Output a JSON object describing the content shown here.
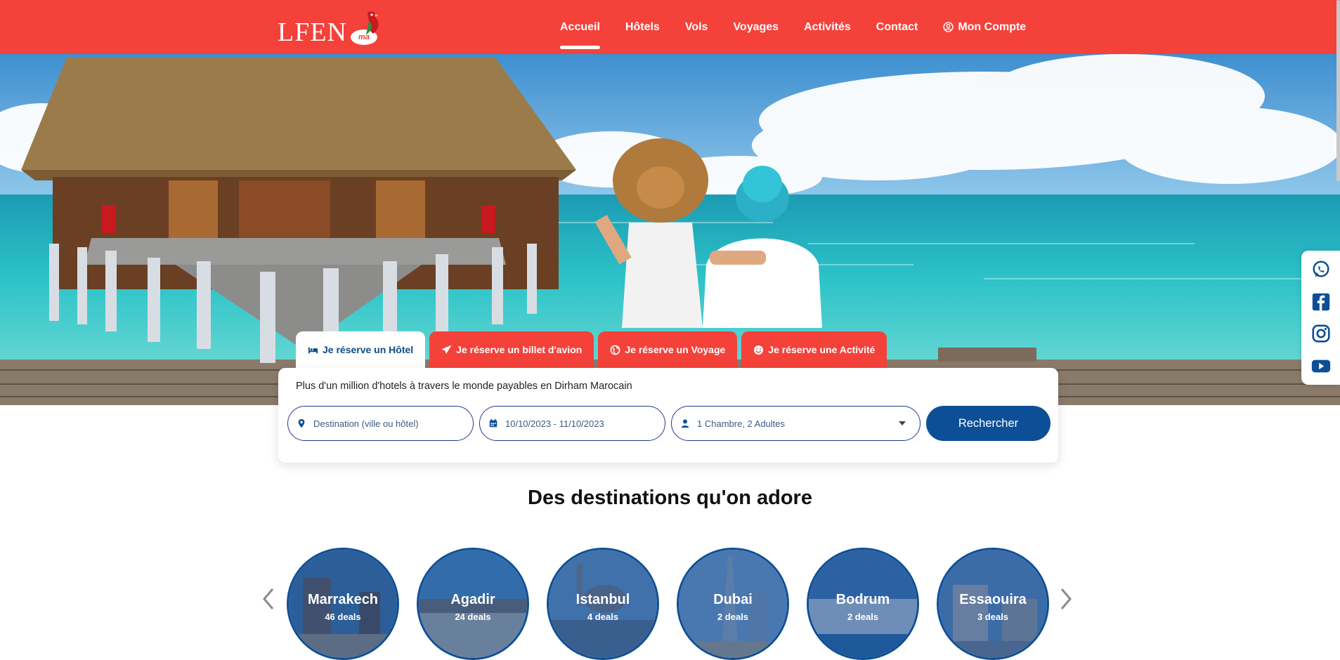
{
  "brand": {
    "logo_text": "LFEN",
    "logo_badge": "ma",
    "colors": {
      "primary_red": "#f4413a",
      "primary_blue": "#0d4f96",
      "white": "#ffffff"
    }
  },
  "nav": {
    "items": [
      {
        "label": "Accueil",
        "active": true
      },
      {
        "label": "Hôtels"
      },
      {
        "label": "Vols"
      },
      {
        "label": "Voyages"
      },
      {
        "label": "Activités"
      },
      {
        "label": "Contact"
      }
    ],
    "account_label": "Mon Compte",
    "account_icon": "user-circle-icon"
  },
  "social": [
    "whatsapp-icon",
    "facebook-icon",
    "instagram-icon",
    "youtube-icon"
  ],
  "tabs": [
    {
      "label": "Je réserve un Hôtel",
      "icon": "bed-icon",
      "active": true
    },
    {
      "label": "Je réserve un billet d'avion",
      "icon": "plane-icon"
    },
    {
      "label": "Je réserve un Voyage",
      "icon": "globe-icon"
    },
    {
      "label": "Je réserve une Activité",
      "icon": "smile-icon"
    }
  ],
  "search": {
    "tagline": "Plus d'un million d'hotels à travers le monde payables en Dirham Marocain",
    "destination_placeholder": "Destination (ville ou hôtel)",
    "dates_value": "10/10/2023 - 11/10/2023",
    "guests_value": "1 Chambre, 2 Adultes",
    "button_label": "Rechercher"
  },
  "destinations": {
    "title": "Des destinations qu'on adore",
    "items": [
      {
        "name": "Marrakech",
        "deals": "46 deals"
      },
      {
        "name": "Agadir",
        "deals": "24 deals"
      },
      {
        "name": "Istanbul",
        "deals": "4 deals"
      },
      {
        "name": "Dubai",
        "deals": "2 deals"
      },
      {
        "name": "Bodrum",
        "deals": "2 deals"
      },
      {
        "name": "Essaouira",
        "deals": "3 deals"
      }
    ]
  }
}
